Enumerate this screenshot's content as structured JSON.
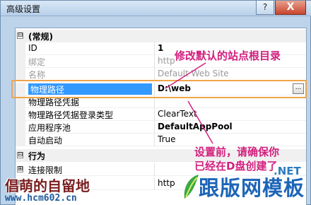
{
  "window": {
    "title": "高级设置",
    "help_label": "?",
    "close_label": "X"
  },
  "grid": {
    "groups": [
      {
        "toggle": "⊟",
        "label": "(常规)"
      },
      {
        "toggle": "⊟",
        "label": "行为"
      }
    ],
    "rows": [
      {
        "label": "ID",
        "value": "1"
      },
      {
        "label": "绑定",
        "value": "http"
      },
      {
        "label": "名称",
        "value": "Default Web Site"
      },
      {
        "label": "物理路径",
        "value": "D:\\web",
        "button": "..."
      },
      {
        "label": "物理路径凭据",
        "value": ""
      },
      {
        "label": "物理路径凭据登录类型",
        "value": "ClearText"
      },
      {
        "label": "应用程序池",
        "value": "DefaultAppPool"
      },
      {
        "label": "自动启动",
        "value": "True"
      },
      {
        "toggle": "⊞",
        "label": "连接限制",
        "value": ""
      },
      {
        "toggle": "⊞",
        "label": "",
        "value": "http"
      }
    ]
  },
  "annotations": {
    "note1": "修改默认的站点根目录",
    "note2_line1": "设置前，请确保你",
    "note2_line2": "已经在D盘创建了"
  },
  "watermarks": {
    "left_title": "倡萌的自留地",
    "left_url": "www.hcm602.cn",
    "right_net": ".NET",
    "right_title": "跟版网模板"
  },
  "colors": {
    "annotation": "#d2207e",
    "highlight_box": "#f0a44a",
    "selection": "#3399ff"
  }
}
